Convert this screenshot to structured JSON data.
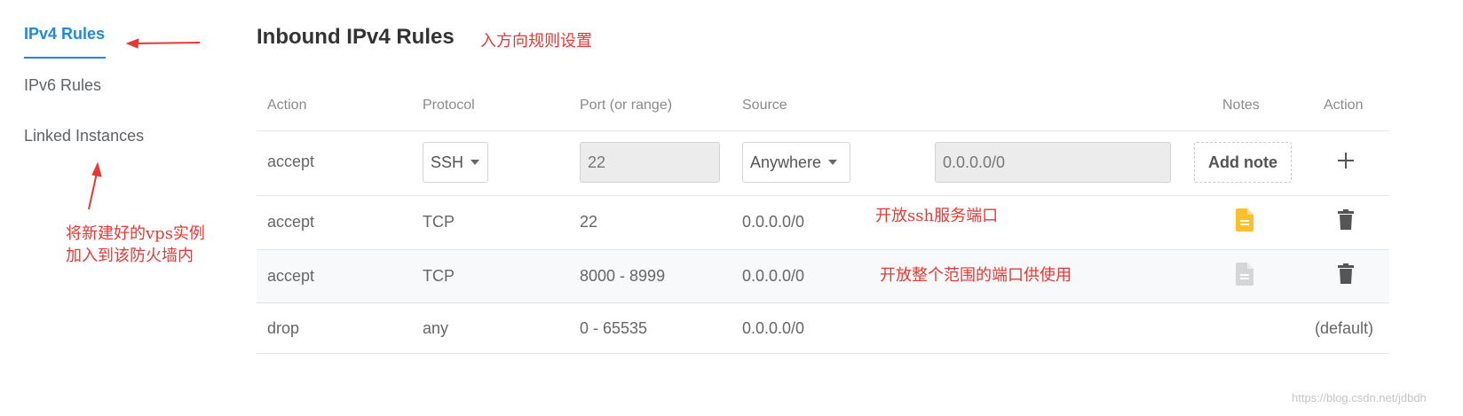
{
  "sidebar": {
    "items": [
      {
        "label": "IPv4 Rules"
      },
      {
        "label": "IPv6 Rules"
      },
      {
        "label": "Linked Instances"
      }
    ]
  },
  "header": {
    "title": "Inbound IPv4 Rules",
    "annotation": "入方向规则设置"
  },
  "annotations": {
    "linked_instances_line1": "将新建好的vps实例",
    "linked_instances_line2": "加入到该防火墙内",
    "ssh_note": "开放ssh服务端口",
    "range_note": "开放整个范围的端口供使用"
  },
  "table": {
    "headers": {
      "action": "Action",
      "protocol": "Protocol",
      "port": "Port (or range)",
      "source": "Source",
      "notes": "Notes",
      "action2": "Action"
    },
    "new_rule": {
      "action": "accept",
      "protocol": "SSH",
      "port": "22",
      "source": "Anywhere",
      "source_ip": "0.0.0.0/0",
      "add_note": "Add note"
    },
    "rows": [
      {
        "action": "accept",
        "protocol": "TCP",
        "port": "22",
        "source": "0.0.0.0/0",
        "note_icon": "note-filled-icon",
        "action_icon": "trash-icon"
      },
      {
        "action": "accept",
        "protocol": "TCP",
        "port": "8000 - 8999",
        "source": "0.0.0.0/0",
        "note_icon": "note-empty-icon",
        "action_icon": "trash-icon"
      },
      {
        "action": "drop",
        "protocol": "any",
        "port": "0 - 65535",
        "source": "0.0.0.0/0",
        "action_text": "(default)"
      }
    ]
  },
  "watermark": "https://blog.csdn.net/jdbdh",
  "colors": {
    "accent": "#1e88e5",
    "annotation": "#e53935",
    "note_filled": "#fbc02d",
    "note_empty": "#d6d6d6"
  }
}
